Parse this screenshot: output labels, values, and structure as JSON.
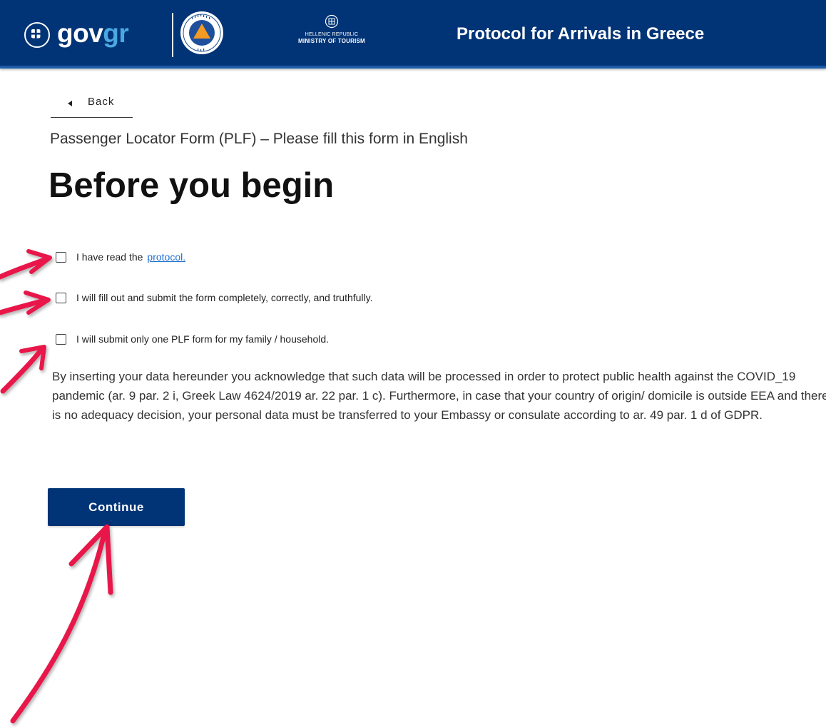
{
  "header": {
    "brand_gov": "gov",
    "brand_gr": "gr",
    "ministry_line1": "HELLENIC REPUBLIC",
    "ministry_line2": "MINISTRY OF TOURISM",
    "title": "Protocol for Arrivals in Greece",
    "icons": [
      "govgr-emblem-icon",
      "civil-protection-logo",
      "ministry-emblem-icon"
    ],
    "colors": {
      "background": "#003476",
      "accent": "#4ba8e0"
    }
  },
  "nav": {
    "back_label": "Back"
  },
  "main": {
    "subtitle": "Passenger Locator Form (PLF) – Please fill this form in English",
    "title": "Before you begin",
    "checkboxes": [
      {
        "label": "I have read the",
        "link": "protocol.",
        "checked": false
      },
      {
        "label": "I will fill out and submit the form completely, correctly, and truthfully.",
        "checked": false
      },
      {
        "label": "I will submit only one PLF form for my family / household.",
        "checked": false
      }
    ],
    "disclaimer": "By inserting your data hereunder you acknowledge that such data will be processed in order to protect public health against the COVID_19 pandemic (ar. 9 par. 2 i, Greek Law 4624/2019 ar. 22 par. 1 c). Furthermore, in case that your country of origin/ domicile is outside EEA and there is no adequacy decision, your personal data must be transferred to your Embassy or consulate according to ar. 49 par. 1 d of GDPR.",
    "continue_label": "Continue"
  },
  "annotations": {
    "color": "#e8194a"
  }
}
